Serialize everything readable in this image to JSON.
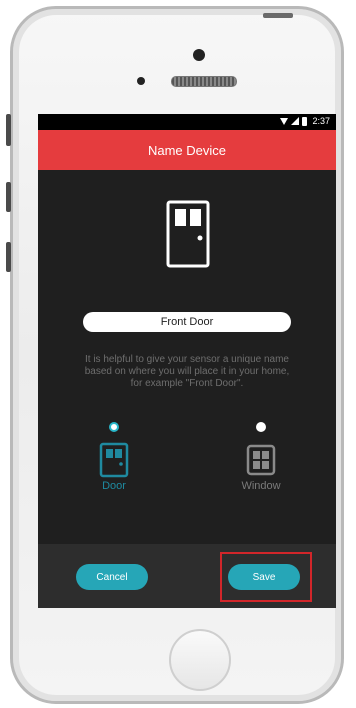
{
  "status_bar": {
    "time": "2:37",
    "icons": [
      "wifi-icon",
      "signal-icon",
      "battery-icon"
    ]
  },
  "app_bar": {
    "title": "Name Device",
    "color": "#e53c3e"
  },
  "device_icon": "door-icon",
  "name_field": {
    "value": "Front Door",
    "placeholder": ""
  },
  "help_text": "It is helpful to give your sensor a unique name based on where you will place it in your home, for example \"Front Door\".",
  "device_types": [
    {
      "label": "Door",
      "icon": "door-icon",
      "selected": true
    },
    {
      "label": "Window",
      "icon": "window-icon",
      "selected": false
    }
  ],
  "actions": {
    "cancel_label": "Cancel",
    "save_label": "Save"
  },
  "colors": {
    "accent": "#26a6b7",
    "highlight": "#d2262a",
    "background": "#1f1f1f"
  }
}
